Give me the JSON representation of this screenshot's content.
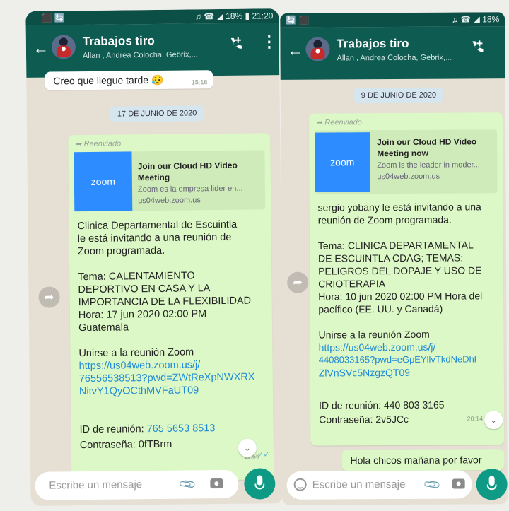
{
  "left": {
    "status": {
      "left": "⬛ 🔄",
      "right": "♫ ☎ ◢ 18% ▮ 21:20"
    },
    "chat": {
      "title": "Trabajos tiro",
      "subtitle": "Allan , Andrea Colocha, Gebrix,..."
    },
    "prev_message": {
      "text": "Creo que llegue tarde 😥",
      "time": "15:18"
    },
    "date_chip": "17 DE JUNIO DE 2020",
    "message": {
      "forwarded": "➦ Reenviado",
      "preview": {
        "logo": "zoom",
        "title": [
          "Join our Cloud HD Video",
          "Meeting"
        ],
        "desc": "Zoom es la empresa lider en...",
        "domain": "us04web.zoom.us"
      },
      "lines": [
        "Clinica Departamental de Escuintla",
        "le está invitando a una reunión de",
        "Zoom programada.",
        "",
        "Tema:  CALENTAMIENTO",
        "DEPORTIVO EN CASA Y LA",
        "IMPORTANCIA DE LA FLEXIBILIDAD",
        "Hora: 17 jun 2020 02:00 PM",
        "Guatemala",
        "",
        "Unirse a la reunión Zoom"
      ],
      "link": [
        "https://us04web.zoom.us/j/",
        "76556538513?pwd=ZWtReXpNWXRX",
        "NitvY1QyOCthMVFaUT09"
      ],
      "meeting_id_label": "ID de reunión: ",
      "meeting_id": "765 5653 8513",
      "password": "Contraseña: 0fTBrm",
      "time": "11:56"
    },
    "input": {
      "placeholder": "Escribe un mensaje"
    }
  },
  "right": {
    "status": {
      "left": "🔄 ⬛",
      "right": "♫ ☎ ◢ 18%"
    },
    "chat": {
      "title": "Trabajos tiro",
      "subtitle": "Allan , Andrea Colocha, Gebrix,..."
    },
    "date_chip": "9 DE JUNIO DE 2020",
    "message": {
      "forwarded": "➦ Reenviado",
      "preview": {
        "logo": "zoom",
        "title": [
          "Join our Cloud HD Video",
          "Meeting now"
        ],
        "desc": "Zoom is the leader in moder...",
        "domain": "us04web.zoom.us"
      },
      "lines": [
        "sergio yobany le está invitando a una",
        "reunión de Zoom programada.",
        "",
        "Tema: CLINICA DEPARTAMENTAL",
        "DE ESCUINTLA CDAG; TEMAS:",
        "PELIGROS DEL DOPAJE Y USO DE",
        "CRIOTERAPIA",
        "Hora: 10 jun 2020 02:00 PM Hora del",
        "pacífico (EE. UU. y Canadá)",
        "",
        "Unirse a la reunión Zoom"
      ],
      "link": [
        "https://us04web.zoom.us/j/",
        "4408033165?pwd=eGpEYllvTkdNeDhl",
        "ZlVnSVc5NzgzQT09"
      ],
      "meeting_id": "ID de reunión: 440 803 3165",
      "password": "Contraseña: 2v5JCc",
      "time": "20:14"
    },
    "next_message": "Hola chicos mañana por favor",
    "input": {
      "placeholder": "Escribe un mensaje"
    }
  },
  "colors": {
    "header": "#0e5b52",
    "outgoing_bubble": "#dcf8c6",
    "link": "#1f8bd6",
    "mic": "#0f9a86",
    "zoom": "#2d8cff"
  }
}
